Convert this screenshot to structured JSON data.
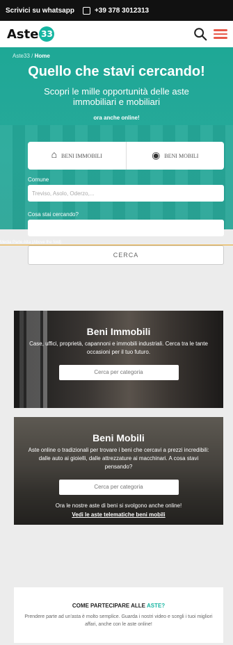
{
  "topbar": {
    "whatsapp_label": "Scrivici su whatsapp",
    "phone": "+39 378 3012313"
  },
  "header": {
    "logo_text": "Aste",
    "logo_number": "33"
  },
  "breadcrumb": {
    "home": "Aste33",
    "sep": "/",
    "current": "Home"
  },
  "hero": {
    "title": "Quello che stavi cercando!",
    "subtitle": "Scopri le mille opportunità delle aste immobiliari e mobiliari",
    "online": "ora anche online!"
  },
  "search": {
    "tabs": [
      {
        "label": "BENI IMMOBILI",
        "icon": "building-icon"
      },
      {
        "label": "BENI MOBILI",
        "icon": "car-icon"
      }
    ],
    "comune_label": "Comune",
    "comune_placeholder": "Treviso, Asolo, Oderzo,...",
    "cosa_label": "Cosa stai cercando?",
    "cosa_placeholder": "",
    "button": "CERCA",
    "fold_label": "Media Parte Alta (Above the fold)"
  },
  "cards": [
    {
      "title": "Beni Immobili",
      "text": "Case, uffici, proprietà, capannoni e immobili industriali. Cerca tra le tante occasioni per il tuo futuro.",
      "button": "Cerca per categoria"
    },
    {
      "title": "Beni Mobili",
      "text": "Aste online o tradizionali per trovare i beni che cercavi a prezzi incredibili: dalle auto ai gioielli, dalle attrezzature ai macchinari. A cosa stavi pensando?",
      "button": "Cerca per categoria",
      "note": "Ora le nostre aste di beni si svolgono anche online!",
      "link": "Vedi le aste telematiche beni mobili"
    }
  ],
  "partecipare": {
    "title": "COME PARTECIPARE ALLE",
    "title_accent": "ASTE?",
    "text": "Prendere parte ad un'asta è molto semplice. Guarda i nostri video e scegli i tuoi migliori affari, anche con le aste online!"
  },
  "colors": {
    "accent": "#17b6a2",
    "menu": "#e8594a",
    "fold_line": "#e8a321"
  }
}
